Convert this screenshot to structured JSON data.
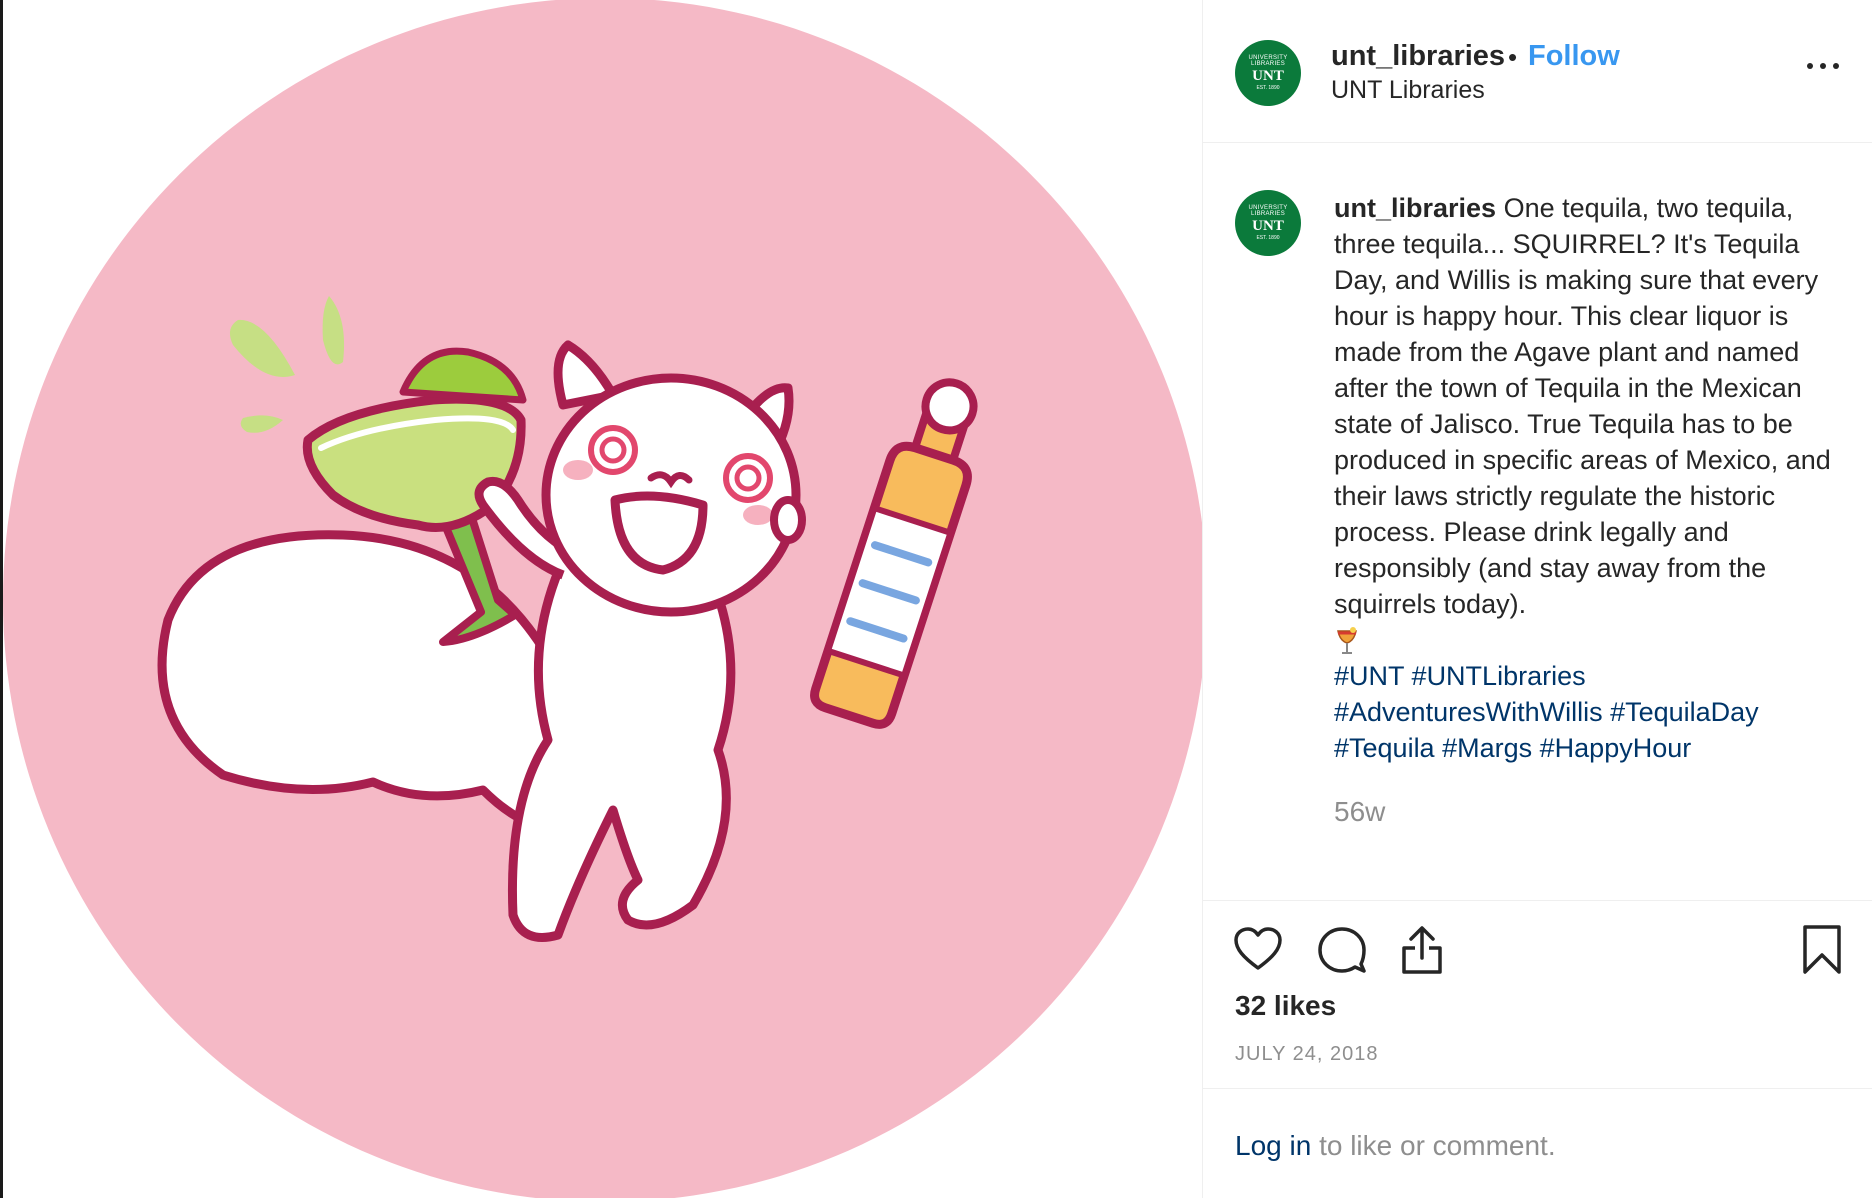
{
  "colors": {
    "follow": "#3897f0",
    "hashtag": "#003569",
    "muted": "#8e8e8e",
    "avatar_green": "#0b7a3b",
    "illustration_background": "#f5b9c6",
    "outline": "#a81f4f"
  },
  "post": {
    "image_alt": "Cartoon white squirrel holding a margarita glass and a tequila bottle on a pink circle"
  },
  "header": {
    "avatar_text": {
      "top": "UNIVERSITY LIBRARIES",
      "middle": "UNT",
      "bottom": "EST. 1890"
    },
    "username": "unt_libraries",
    "separator": "•",
    "follow_label": "Follow",
    "subtitle": "UNT Libraries",
    "more_icon": "more-horizontal-icon"
  },
  "caption": {
    "username": "unt_libraries",
    "text": "One tequila, two tequila, three tequila... SQUIRREL? It's Tequila Day, and Willis is making sure that every hour is happy hour. This clear liquor is made from the Agave plant and named after the town of Tequila in the Mexican state of Jalisco. True Tequila has to be produced in specific areas of Mexico, and their laws strictly regulate the historic process. Please drink legally and responsibly (and stay away from the squirrels today).",
    "emoji": "cocktail-icon",
    "hashtags": [
      "#UNT",
      "#UNTLibraries",
      "#AdventuresWithWillis",
      "#TequilaDay",
      "#Tequila",
      "#Margs",
      "#HappyHour"
    ],
    "age": "56w"
  },
  "actions": {
    "icons": [
      "heart-icon",
      "comment-icon",
      "share-icon",
      "bookmark-icon"
    ],
    "likes": "32 likes",
    "date": "JULY 24, 2018"
  },
  "footer": {
    "login_label": "Log in",
    "login_suffix": " to like or comment."
  }
}
